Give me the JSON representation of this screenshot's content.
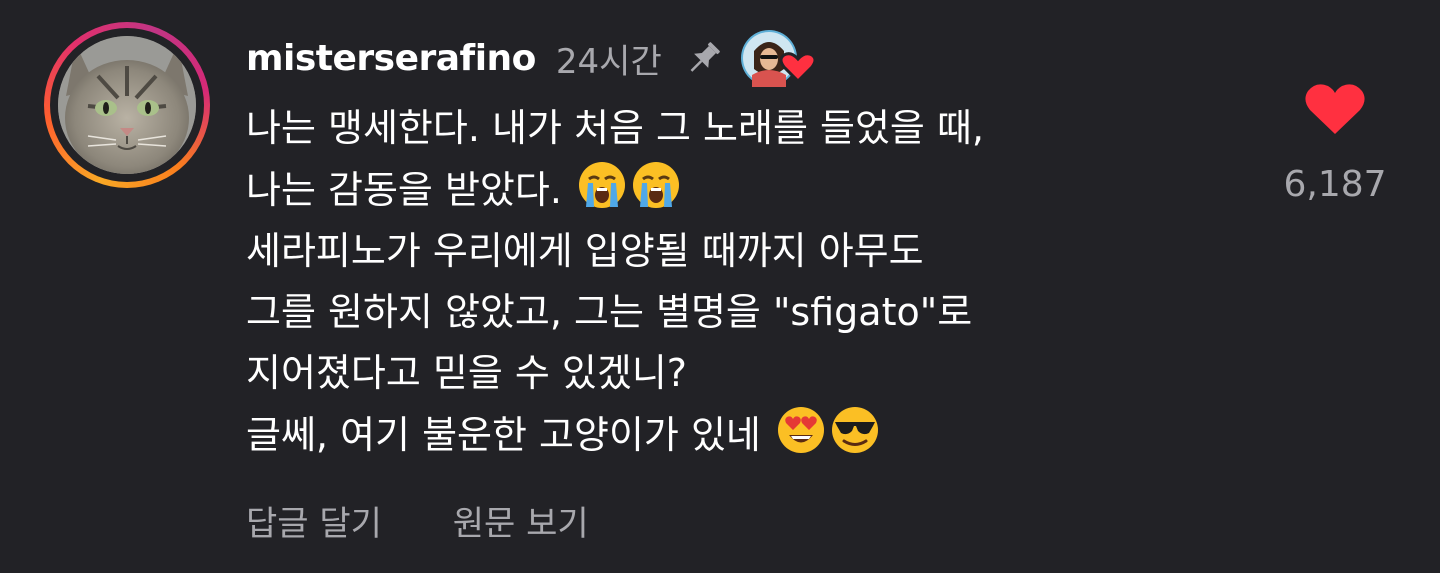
{
  "comment": {
    "username": "misterserafino",
    "time": "24시간",
    "pinned_icon": "pin-icon",
    "creator_liked_icon": "creator-heart-icon",
    "lines": [
      "나는 맹세한다. 내가 처음 그 노래를 들었을 때,",
      "나는 감동을 받았다.",
      "세라피노가 우리에게 입양될 때까지 아무도",
      "그를 원하지 않았고, 그는 별명을 \"sfigato\"로",
      "지어졌다고 믿을 수 있겠니?",
      "글쎄, 여기 불운한 고양이가 있네"
    ],
    "reply_label": "답글 달기",
    "see_original_label": "원문 보기",
    "like_count": "6,187",
    "like_icon": "heart-icon"
  },
  "colors": {
    "background": "#222226",
    "text": "#ffffff",
    "muted": "#a8a8ad",
    "heart": "#ff3040"
  }
}
